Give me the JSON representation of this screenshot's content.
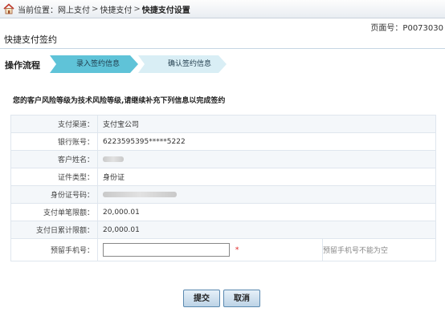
{
  "breadcrumb": {
    "prefix": "当前位置：",
    "items": [
      "网上支付",
      "快捷支付",
      "快捷支付设置"
    ],
    "separator": ">"
  },
  "page_number": "页面号：P0073030",
  "page_title": "快捷支付签约",
  "flow": {
    "label": "操作流程",
    "steps": [
      {
        "label": "录入签约信息",
        "active": true
      },
      {
        "label": "确认签约信息",
        "active": false
      }
    ]
  },
  "notice": "您的客户风险等级为技术风险等级,请继续补充下列信息以完成签约",
  "form": {
    "rows": [
      {
        "label": "支付渠道：",
        "value": "支付宝公司"
      },
      {
        "label": "银行账号：",
        "value": "6223595395*****5222"
      },
      {
        "label": "客户姓名：",
        "value": ""
      },
      {
        "label": "证件类型：",
        "value": "身份证"
      },
      {
        "label": "身份证号码：",
        "value": ""
      },
      {
        "label": "支付单笔限额：",
        "value": "20,000.01"
      },
      {
        "label": "支付日累计限额：",
        "value": "20,000.01"
      }
    ],
    "phone": {
      "label": "预留手机号：",
      "value": "",
      "required_mark": "*",
      "hint": "预留手机号不能为空"
    }
  },
  "buttons": {
    "submit": "提交",
    "cancel": "取消"
  },
  "colors": {
    "step_active": "#5fc3d8",
    "step_inactive": "#d9eef5",
    "required": "#e02020",
    "button_border": "#5a89b0"
  }
}
